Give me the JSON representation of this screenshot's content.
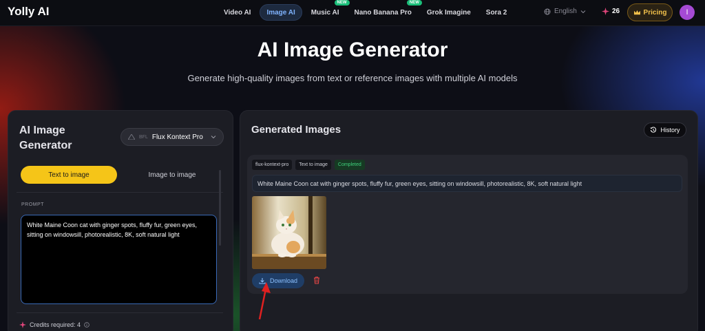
{
  "header": {
    "logo": "Yolly AI",
    "nav": [
      {
        "label": "Video AI",
        "active": false,
        "new": false
      },
      {
        "label": "Image AI",
        "active": true,
        "new": false
      },
      {
        "label": "Music AI",
        "active": false,
        "new": true
      },
      {
        "label": "Nano Banana Pro",
        "active": false,
        "new": true
      },
      {
        "label": "Grok Imagine",
        "active": false,
        "new": false
      },
      {
        "label": "Sora 2",
        "active": false,
        "new": false
      }
    ],
    "new_badge": "NEW",
    "language": "English",
    "credits": "26",
    "pricing_label": "Pricing",
    "avatar_initial": "I"
  },
  "hero": {
    "title": "AI Image Generator",
    "subtitle": "Generate high-quality images from text or reference images with multiple AI models"
  },
  "generator": {
    "title": "AI Image Generator",
    "model_mini": "BFL",
    "model": "Flux Kontext Pro",
    "tabs": [
      {
        "label": "Text to image",
        "active": true
      },
      {
        "label": "Image to image",
        "active": false
      }
    ],
    "prompt_label": "PROMPT",
    "prompt_value": "White Maine Coon cat with ginger spots, fluffy fur, green eyes, sitting on windowsill, photorealistic, 8K, soft natural light",
    "credits_required": "Credits required: 4"
  },
  "results": {
    "title": "Generated Images",
    "history_label": "History",
    "item": {
      "tags": [
        "flux-kontext-pro",
        "Text to image",
        "Completed"
      ],
      "prompt": "White Maine Coon cat with ginger spots, fluffy fur, green eyes, sitting on windowsill, photorealistic, 8K, soft natural light",
      "download_label": "Download"
    }
  },
  "colors": {
    "accent_yellow": "#f5c518",
    "accent_blue": "#7fb3ff",
    "status_green": "#3fd17b",
    "delete_red": "#e04545",
    "annotation_arrow": "#e02020"
  }
}
